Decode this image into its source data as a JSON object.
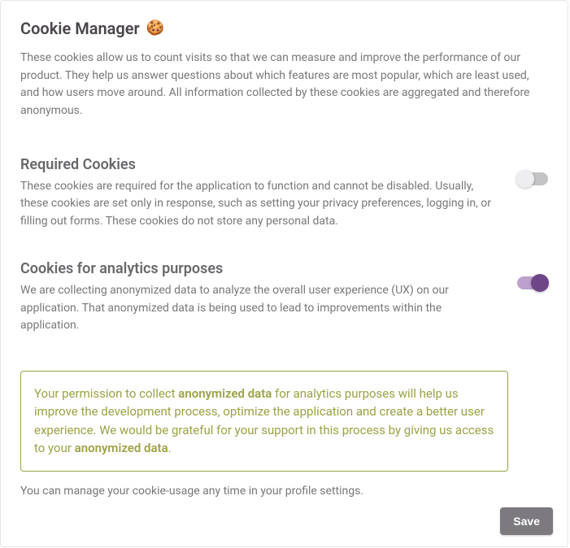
{
  "title": "Cookie Manager",
  "icon": "🍪",
  "intro": "These cookies allow us to count visits so that we can measure and improve the performance of our product. They help us answer questions about which features are most popular, which are least used, and how users move around. All information collected by these cookies are aggregated and therefore anonymous.",
  "sections": {
    "required": {
      "title": "Required Cookies",
      "desc": "These cookies are required for the application to function and cannot be disabled. Usually, these cookies are set only in response, such as setting your privacy preferences, logging in, or filling out forms. These cookies do not store any personal data.",
      "enabled": false,
      "disabled_toggle": true
    },
    "analytics": {
      "title": "Cookies for analytics purposes",
      "desc": "We are collecting anonymized data to analyze the overall user experience (UX) on our application. That anonymized data is being used to lead to improvements within the application.",
      "enabled": true,
      "disabled_toggle": false
    }
  },
  "callout": {
    "pre": "Your permission to collect ",
    "bold1": "anonymized data",
    "mid": " for analytics purposes will help us improve the development process, optimize the application and create a better user experience. We would be grateful for your support in this process by giving us access to your ",
    "bold2": "anonymized data",
    "post": "."
  },
  "footer_note": "You can manage your cookie-usage any time in your profile settings.",
  "save_label": "Save"
}
